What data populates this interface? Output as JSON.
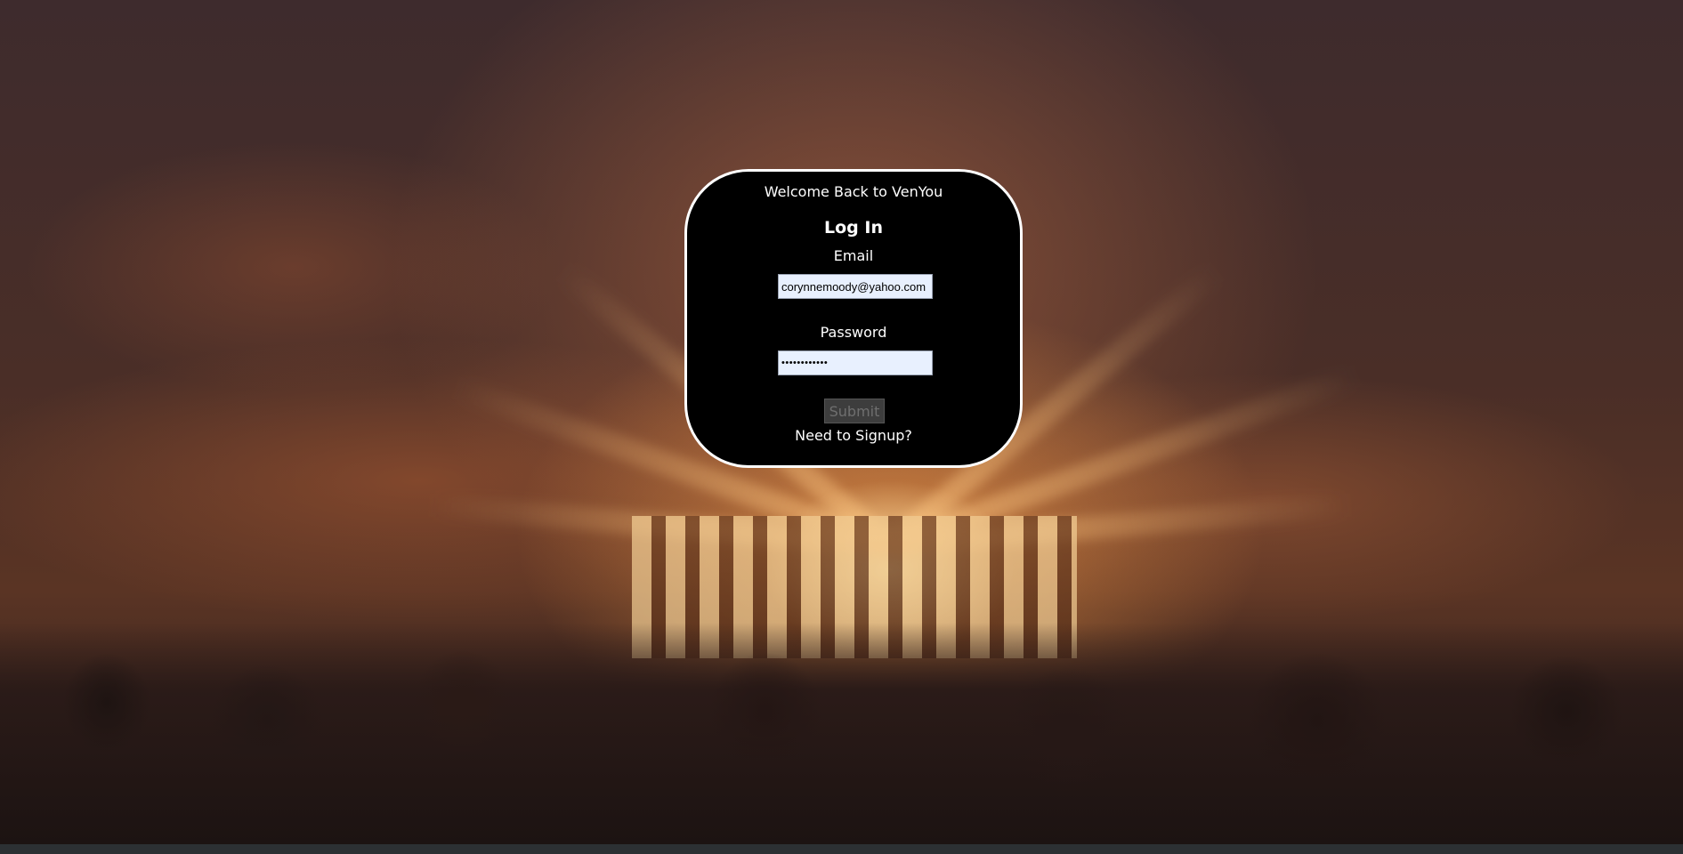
{
  "login": {
    "welcome": "Welcome Back to VenYou",
    "heading": "Log In",
    "email_label": "Email",
    "email_value": "corynnemoody@yahoo.com",
    "password_label": "Password",
    "password_value": "password1234",
    "submit_label": "Submit",
    "signup_link": "Need to Signup?"
  },
  "colors": {
    "card_background": "#000000",
    "card_border": "#ffffff",
    "input_background": "#e8f0fe",
    "submit_background": "#3d3d3d"
  }
}
